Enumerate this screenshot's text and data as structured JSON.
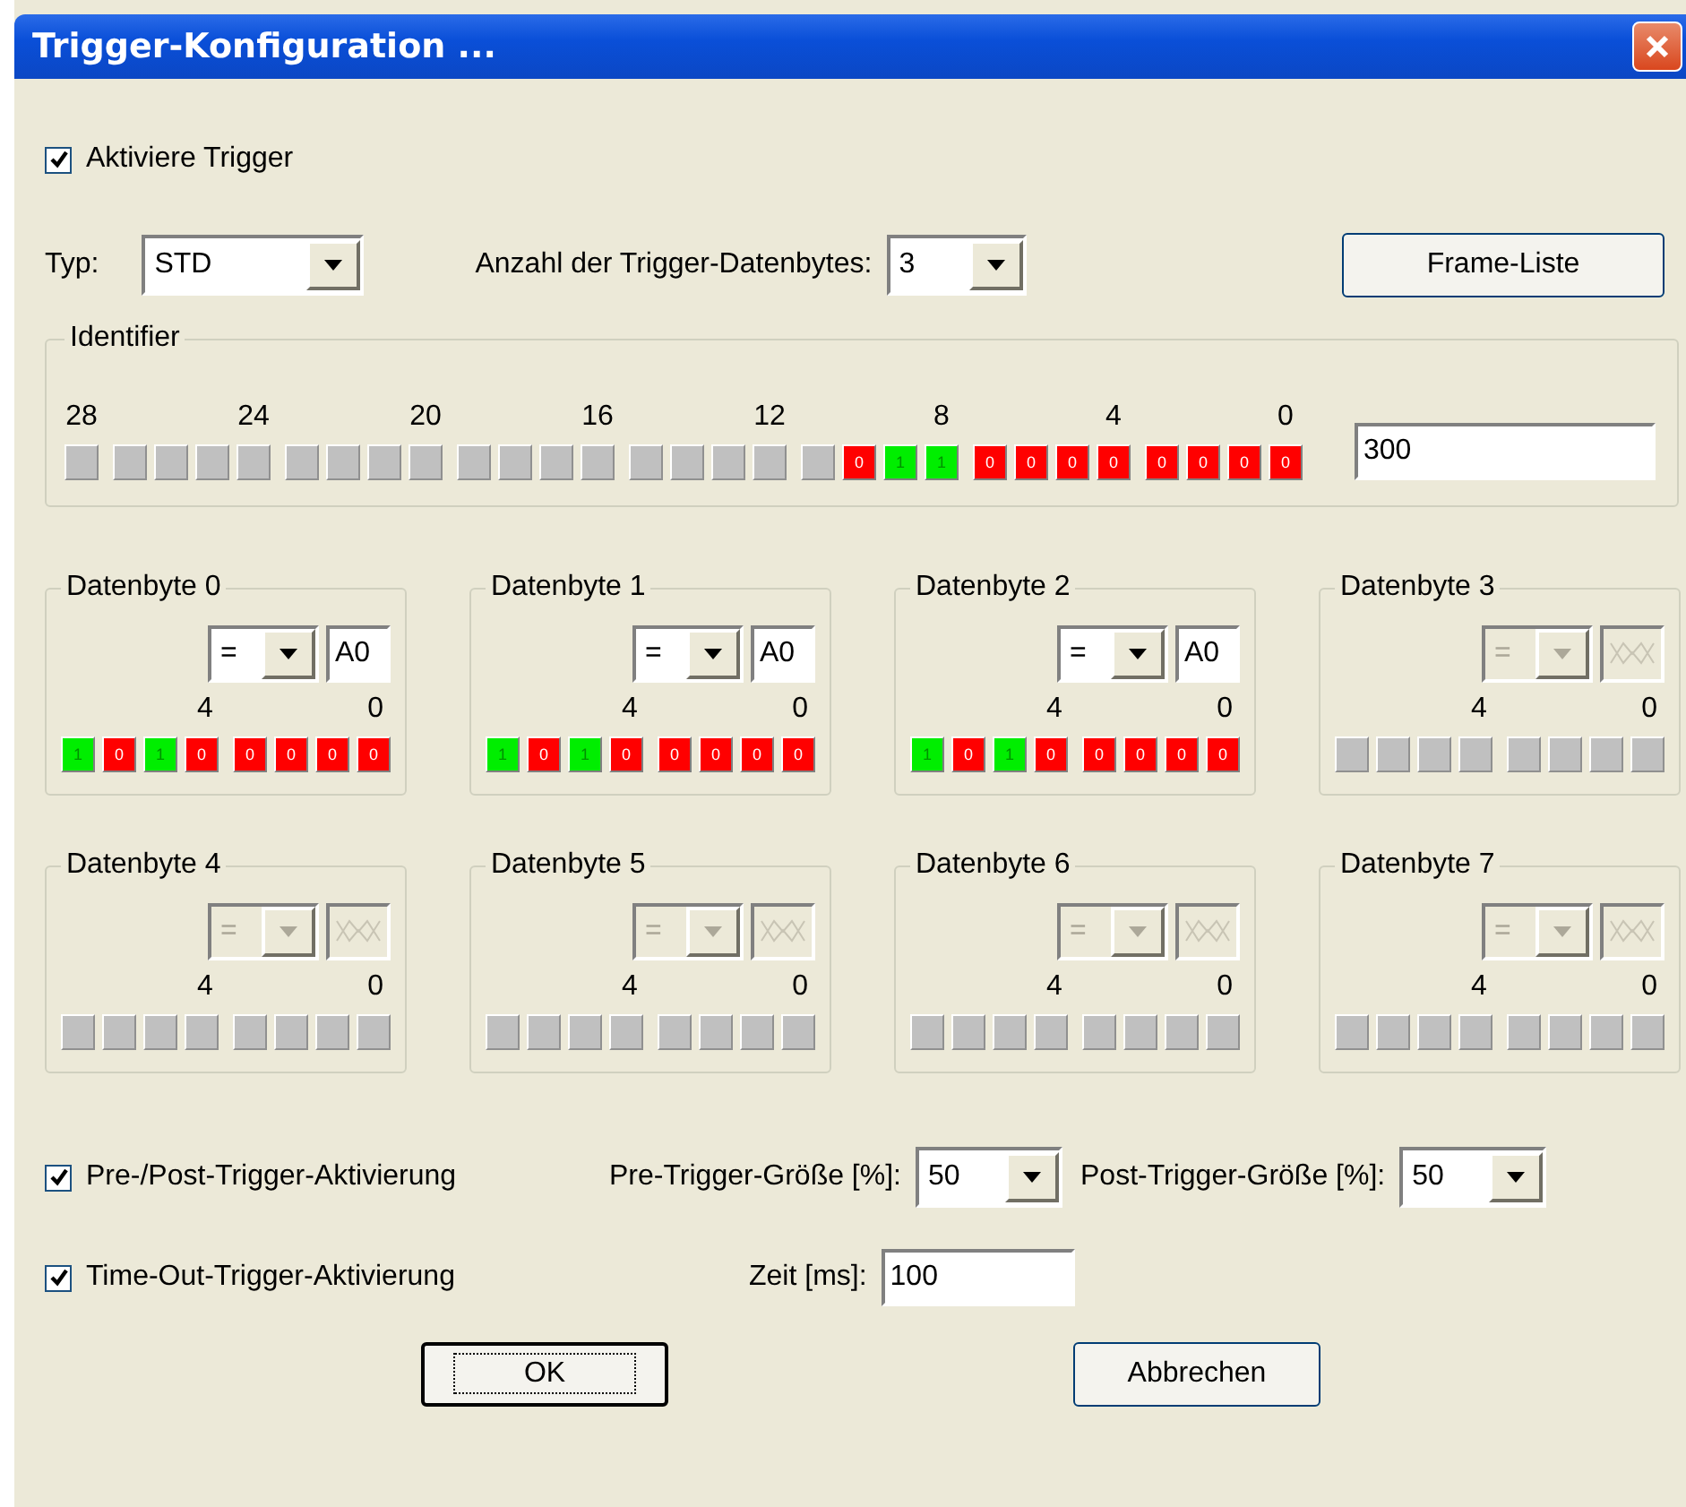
{
  "window": {
    "title": "Trigger-Konfiguration ..."
  },
  "activate": {
    "label": "Aktiviere Trigger",
    "checked": true
  },
  "type": {
    "label": "Typ:",
    "value": "STD"
  },
  "byte_count": {
    "label": "Anzahl der Trigger-Datenbytes:",
    "value": "3"
  },
  "frame_list_button": "Frame-Liste",
  "identifier": {
    "title": "Identifier",
    "value": "300",
    "bits": [
      {
        "kind": "unused",
        "tick": "28"
      },
      {
        "kind": "unused"
      },
      {
        "kind": "unused"
      },
      {
        "kind": "unused"
      },
      {
        "kind": "unused",
        "tick": "24"
      },
      {
        "kind": "unused"
      },
      {
        "kind": "unused"
      },
      {
        "kind": "unused"
      },
      {
        "kind": "unused",
        "tick": "20"
      },
      {
        "kind": "unused"
      },
      {
        "kind": "unused"
      },
      {
        "kind": "unused"
      },
      {
        "kind": "unused",
        "tick": "16"
      },
      {
        "kind": "unused"
      },
      {
        "kind": "unused"
      },
      {
        "kind": "unused"
      },
      {
        "kind": "unused",
        "tick": "12"
      },
      {
        "kind": "unused"
      },
      {
        "kind": "bit",
        "value": "0",
        "on": false
      },
      {
        "kind": "bit",
        "value": "1",
        "on": true
      },
      {
        "kind": "bit",
        "value": "1",
        "on": true,
        "tick": "8"
      },
      {
        "kind": "bit",
        "value": "0",
        "on": false
      },
      {
        "kind": "bit",
        "value": "0",
        "on": false
      },
      {
        "kind": "bit",
        "value": "0",
        "on": false
      },
      {
        "kind": "bit",
        "value": "0",
        "on": false,
        "tick": "4"
      },
      {
        "kind": "bit",
        "value": "0",
        "on": false
      },
      {
        "kind": "bit",
        "value": "0",
        "on": false
      },
      {
        "kind": "bit",
        "value": "0",
        "on": false
      },
      {
        "kind": "bit",
        "value": "0",
        "on": false,
        "tick": "0"
      }
    ]
  },
  "data_bytes": [
    {
      "title": "Datenbyte 0",
      "enabled": true,
      "operator": "=",
      "value": "A0",
      "tick_high": "4",
      "tick_low": "0",
      "bits": [
        {
          "value": "1",
          "on": true
        },
        {
          "value": "0",
          "on": false
        },
        {
          "value": "1",
          "on": true
        },
        {
          "value": "0",
          "on": false
        },
        {
          "value": "0",
          "on": false
        },
        {
          "value": "0",
          "on": false
        },
        {
          "value": "0",
          "on": false
        },
        {
          "value": "0",
          "on": false
        }
      ]
    },
    {
      "title": "Datenbyte 1",
      "enabled": true,
      "operator": "=",
      "value": "A0",
      "tick_high": "4",
      "tick_low": "0",
      "bits": [
        {
          "value": "1",
          "on": true
        },
        {
          "value": "0",
          "on": false
        },
        {
          "value": "1",
          "on": true
        },
        {
          "value": "0",
          "on": false
        },
        {
          "value": "0",
          "on": false
        },
        {
          "value": "0",
          "on": false
        },
        {
          "value": "0",
          "on": false
        },
        {
          "value": "0",
          "on": false
        }
      ]
    },
    {
      "title": "Datenbyte 2",
      "enabled": true,
      "operator": "=",
      "value": "A0",
      "tick_high": "4",
      "tick_low": "0",
      "bits": [
        {
          "value": "1",
          "on": true
        },
        {
          "value": "0",
          "on": false
        },
        {
          "value": "1",
          "on": true
        },
        {
          "value": "0",
          "on": false
        },
        {
          "value": "0",
          "on": false
        },
        {
          "value": "0",
          "on": false
        },
        {
          "value": "0",
          "on": false
        },
        {
          "value": "0",
          "on": false
        }
      ]
    },
    {
      "title": "Datenbyte 3",
      "enabled": false,
      "operator": "=",
      "tick_high": "4",
      "tick_low": "0"
    },
    {
      "title": "Datenbyte 4",
      "enabled": false,
      "operator": "=",
      "tick_high": "4",
      "tick_low": "0"
    },
    {
      "title": "Datenbyte 5",
      "enabled": false,
      "operator": "=",
      "tick_high": "4",
      "tick_low": "0"
    },
    {
      "title": "Datenbyte 6",
      "enabled": false,
      "operator": "=",
      "tick_high": "4",
      "tick_low": "0"
    },
    {
      "title": "Datenbyte 7",
      "enabled": false,
      "operator": "=",
      "tick_high": "4",
      "tick_low": "0"
    }
  ],
  "pre_post": {
    "label": "Pre-/Post-Trigger-Aktivierung",
    "checked": true,
    "pre_label": "Pre-Trigger-Größe [%]:",
    "pre_value": "50",
    "post_label": "Post-Trigger-Größe [%]:",
    "post_value": "50"
  },
  "timeout": {
    "label": "Time-Out-Trigger-Aktivierung",
    "checked": true,
    "time_label": "Zeit [ms]:",
    "time_value": "100"
  },
  "buttons": [
    {
      "label": "OK",
      "focused": true
    },
    {
      "label": "Abbrechen",
      "focused": false
    }
  ]
}
